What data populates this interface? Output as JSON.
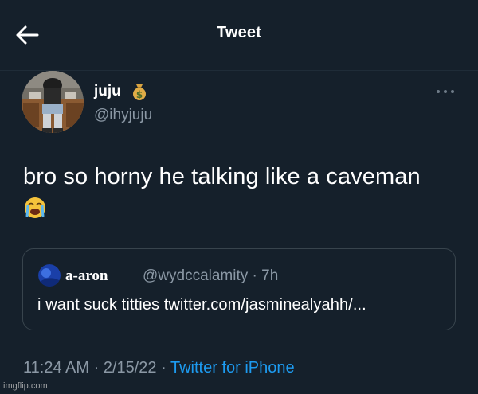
{
  "header": {
    "title": "Tweet",
    "back_icon": "arrow-left-icon"
  },
  "author": {
    "display_name": "juju",
    "name_emoji": "money-bag-icon",
    "handle": "@ihyjuju",
    "more_icon": "more-dots-icon"
  },
  "tweet": {
    "text": "bro so horny he talking like a caveman",
    "emoji": "loudly-crying-face-icon"
  },
  "quote": {
    "display_name": "a-aron",
    "handle": "@wydccalamity",
    "separator": "·",
    "time": "7h",
    "text": "i want suck titties twitter.com/jasminealyahh/..."
  },
  "meta": {
    "time": "11:24 AM",
    "date": "2/15/22",
    "separator": "·",
    "source": "Twitter for iPhone"
  },
  "watermark": "imgflip.com",
  "colors": {
    "background": "#15202b",
    "text": "#ffffff",
    "secondary": "#8b98a5",
    "link": "#1d9bf0",
    "border": "#38444d"
  }
}
